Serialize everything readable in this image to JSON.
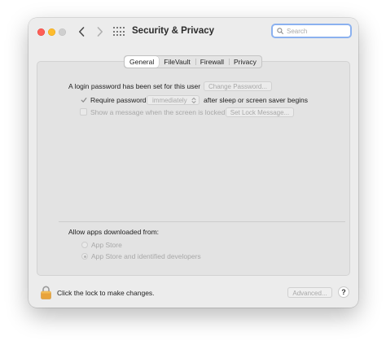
{
  "window": {
    "title": "Security & Privacy"
  },
  "toolbar": {
    "back_icon": "chevron-left-icon",
    "forward_icon": "chevron-right-icon",
    "show_all_icon": "grid-icon"
  },
  "search": {
    "placeholder": "Search",
    "value": "",
    "icon": "search-icon"
  },
  "tabs": [
    {
      "label": "General",
      "active": true
    },
    {
      "label": "FileVault",
      "active": false
    },
    {
      "label": "Firewall",
      "active": false
    },
    {
      "label": "Privacy",
      "active": false
    }
  ],
  "general": {
    "password_message": "A login password has been set for this user",
    "change_password_label": "Change Password...",
    "require_password": {
      "label": "Require password",
      "checked": true,
      "delay_value": "immediately",
      "suffix": "after sleep or screen saver begins"
    },
    "show_message": {
      "label": "Show a message when the screen is locked",
      "checked": false,
      "button_label": "Set Lock Message..."
    },
    "allow_apps": {
      "heading": "Allow apps downloaded from:",
      "options": [
        {
          "label": "App Store",
          "selected": false
        },
        {
          "label": "App Store and identified developers",
          "selected": true
        }
      ]
    }
  },
  "footer": {
    "lock_icon": "lock-icon",
    "lock_text": "Click the lock to make changes.",
    "advanced_label": "Advanced...",
    "help_label": "?"
  },
  "colors": {
    "close": "#fe5f57",
    "minimize": "#febc2e",
    "maximize": "#cfcfcf",
    "search_focus": "#8bb1ef",
    "lock": "#e8a33a"
  }
}
